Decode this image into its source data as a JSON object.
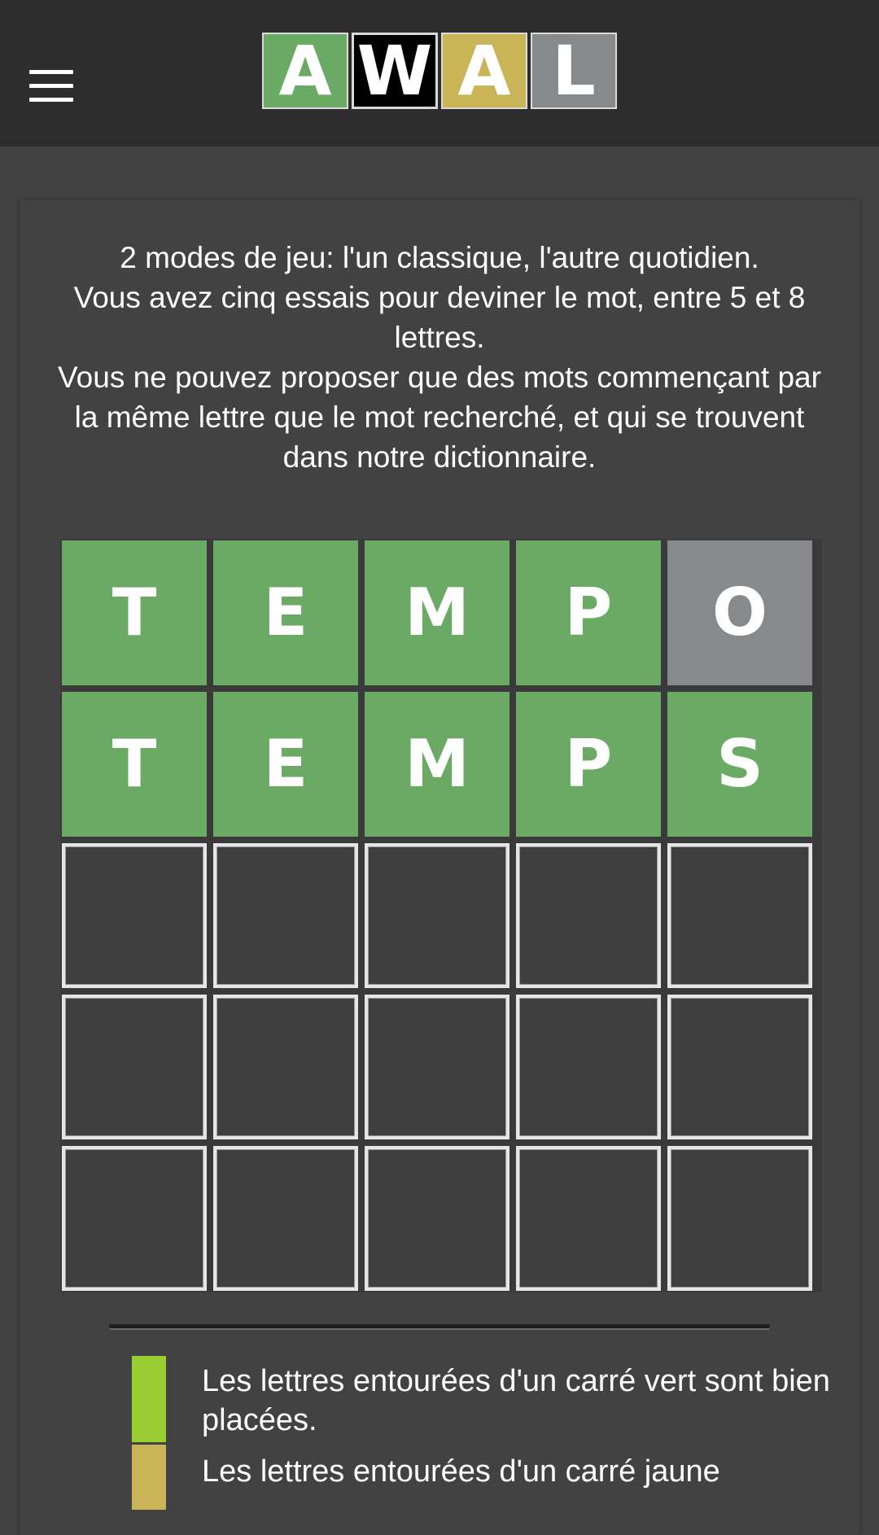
{
  "header": {
    "logo_letters": [
      "A",
      "W",
      "A",
      "L"
    ],
    "logo_colors": [
      "#6aaa64",
      "#000000",
      "#c9b458",
      "#878a8c"
    ]
  },
  "intro": {
    "line1": "2 modes de jeu: l'un classique, l'autre quotidien.",
    "line2": "Vous avez cinq essais pour deviner le mot, entre 5 et 8 lettres.",
    "line3": "Vous ne pouvez proposer que des mots commençant par la même lettre que le mot recherché, et qui se trouvent dans notre dictionnaire."
  },
  "board": {
    "rows": [
      [
        {
          "letter": "T",
          "state": "correct"
        },
        {
          "letter": "E",
          "state": "correct"
        },
        {
          "letter": "M",
          "state": "correct"
        },
        {
          "letter": "P",
          "state": "correct"
        },
        {
          "letter": "O",
          "state": "absent"
        }
      ],
      [
        {
          "letter": "T",
          "state": "correct"
        },
        {
          "letter": "E",
          "state": "correct"
        },
        {
          "letter": "M",
          "state": "correct"
        },
        {
          "letter": "P",
          "state": "correct"
        },
        {
          "letter": "S",
          "state": "correct"
        }
      ],
      [
        {
          "letter": "",
          "state": "empty"
        },
        {
          "letter": "",
          "state": "empty"
        },
        {
          "letter": "",
          "state": "empty"
        },
        {
          "letter": "",
          "state": "empty"
        },
        {
          "letter": "",
          "state": "empty"
        }
      ],
      [
        {
          "letter": "",
          "state": "empty"
        },
        {
          "letter": "",
          "state": "empty"
        },
        {
          "letter": "",
          "state": "empty"
        },
        {
          "letter": "",
          "state": "empty"
        },
        {
          "letter": "",
          "state": "empty"
        }
      ],
      [
        {
          "letter": "",
          "state": "empty"
        },
        {
          "letter": "",
          "state": "empty"
        },
        {
          "letter": "",
          "state": "empty"
        },
        {
          "letter": "",
          "state": "empty"
        },
        {
          "letter": "",
          "state": "empty"
        }
      ]
    ]
  },
  "legend": {
    "green": {
      "color": "#9acd32",
      "text": "Les lettres entourées d'un carré vert sont bien placées."
    },
    "yellow": {
      "color": "#c9b458",
      "text": "Les lettres entourées d'un carré jaune"
    }
  }
}
